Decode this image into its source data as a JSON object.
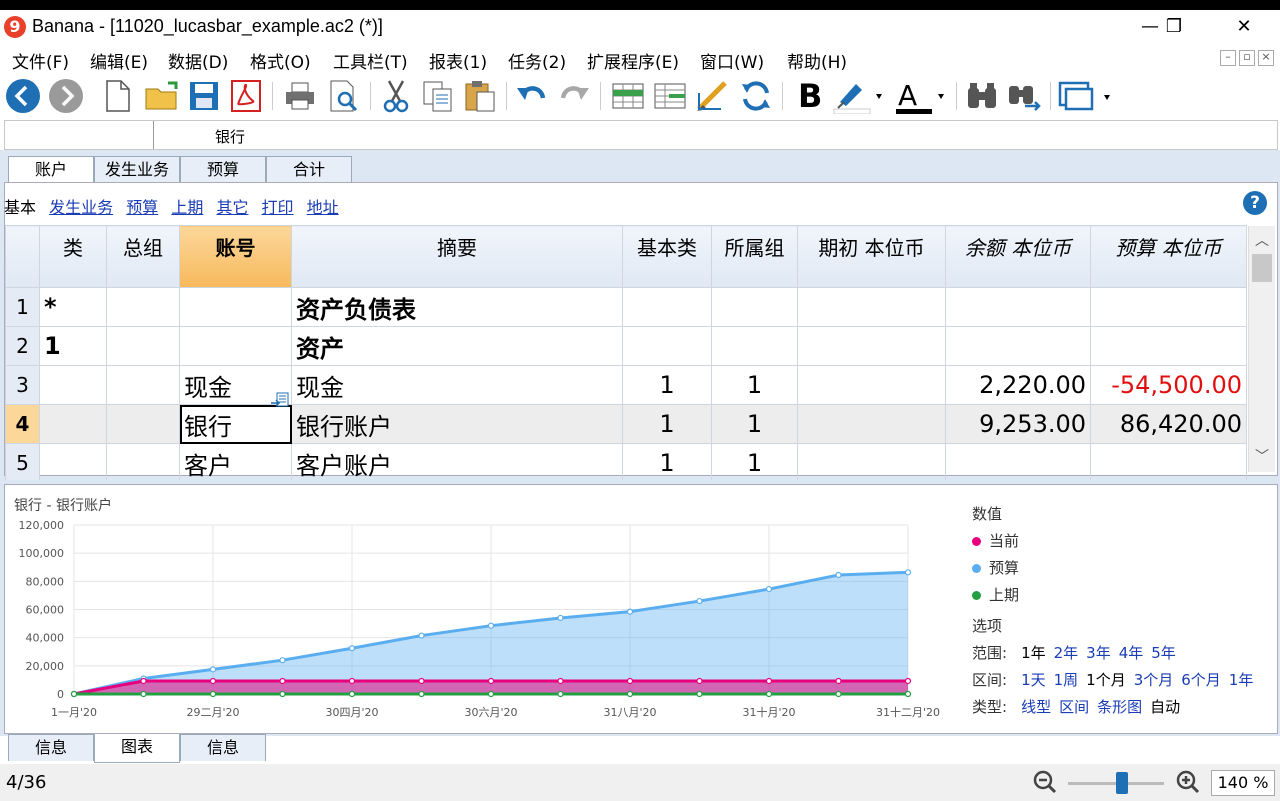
{
  "window": {
    "title": "Banana - [11020_lucasbar_example.ac2 (*)]",
    "logo": "9",
    "minimize": "—",
    "restore": "❐",
    "close": "✕"
  },
  "menu": [
    "文件(F)",
    "编辑(E)",
    "数据(D)",
    "格式(O)",
    "工具栏(T)",
    "报表(1)",
    "任务(2)",
    "扩展程序(E)",
    "窗口(W)",
    "帮助(H)"
  ],
  "mdi": [
    "–",
    "▫",
    "×"
  ],
  "inputbar": {
    "cell_ref": "",
    "content": "银行"
  },
  "tabs_top": [
    "账户",
    "发生业务",
    "预算",
    "合计"
  ],
  "views": {
    "current": "基本",
    "links": [
      "发生业务",
      "预算",
      "上期",
      "其它",
      "打印",
      "地址"
    ]
  },
  "help": "?",
  "table": {
    "headers": [
      "类",
      "总组",
      "账号",
      "摘要",
      "基本类",
      "所属组",
      "期初 本位币",
      "余额 本位币",
      "预算 本位币"
    ],
    "rows": [
      {
        "n": "1",
        "section": "*",
        "group": "",
        "account": "",
        "desc": "资产负债表",
        "bclass": "",
        "gr": "",
        "opening": "",
        "balance": "",
        "budget": ""
      },
      {
        "n": "2",
        "section": "1",
        "group": "",
        "account": "",
        "desc": "资产",
        "bclass": "",
        "gr": "",
        "opening": "",
        "balance": "",
        "budget": ""
      },
      {
        "n": "3",
        "section": "",
        "group": "",
        "account": "现金",
        "desc": "现金",
        "bclass": "1",
        "gr": "1",
        "opening": "",
        "balance": "2,220.00",
        "budget": "-54,500.00"
      },
      {
        "n": "4",
        "section": "",
        "group": "",
        "account": "银行",
        "desc": "银行账户",
        "bclass": "1",
        "gr": "1",
        "opening": "",
        "balance": "9,253.00",
        "budget": "86,420.00"
      },
      {
        "n": "5",
        "section": "",
        "group": "",
        "account": "客户",
        "desc": "客户账户",
        "bclass": "1",
        "gr": "1",
        "opening": "",
        "balance": "",
        "budget": ""
      }
    ]
  },
  "chart_title": "银行 - 银行账户",
  "chart_data": {
    "type": "area",
    "ylim": [
      0,
      120000
    ],
    "yticks": [
      "0",
      "20,000",
      "40,000",
      "60,000",
      "80,000",
      "100,000",
      "120,000"
    ],
    "xticks": [
      "1一月'20",
      "29二月'20",
      "30四月'20",
      "30六月'20",
      "31八月'20",
      "31十月'20",
      "31十二月'20"
    ],
    "series": [
      {
        "name": "预算",
        "color": "#5aaef0",
        "values": [
          0,
          11000,
          17500,
          24000,
          32500,
          41500,
          48500,
          54000,
          58500,
          66000,
          74500,
          84500,
          86400
        ]
      },
      {
        "name": "当前",
        "color": "#e6007e",
        "values": [
          0,
          9253,
          9253,
          9253,
          9253,
          9253,
          9253,
          9253,
          9253,
          9253,
          9253,
          9253,
          9253
        ]
      },
      {
        "name": "上期",
        "color": "#20a040",
        "values": [
          0,
          0,
          0,
          0,
          0,
          0,
          0,
          0,
          0,
          0,
          0,
          0,
          0
        ]
      }
    ]
  },
  "legend": {
    "heading": "数值",
    "items": [
      "当前",
      "预算",
      "上期"
    ],
    "colors": [
      "#e6007e",
      "#5aaef0",
      "#20a040"
    ]
  },
  "options": {
    "heading": "选项",
    "range_label": "范围:",
    "range": [
      "1年",
      "2年",
      "3年",
      "4年",
      "5年"
    ],
    "interval_label": "区间:",
    "interval": [
      "1天",
      "1周",
      "1个月",
      "3个月",
      "6个月",
      "1年"
    ],
    "type_label": "类型:",
    "type": [
      "线型",
      "区间",
      "条形图",
      "自动"
    ]
  },
  "tabs_bottom": [
    "信息",
    "图表",
    "信息"
  ],
  "status": {
    "text": "4/36",
    "zoom": "140 %"
  }
}
